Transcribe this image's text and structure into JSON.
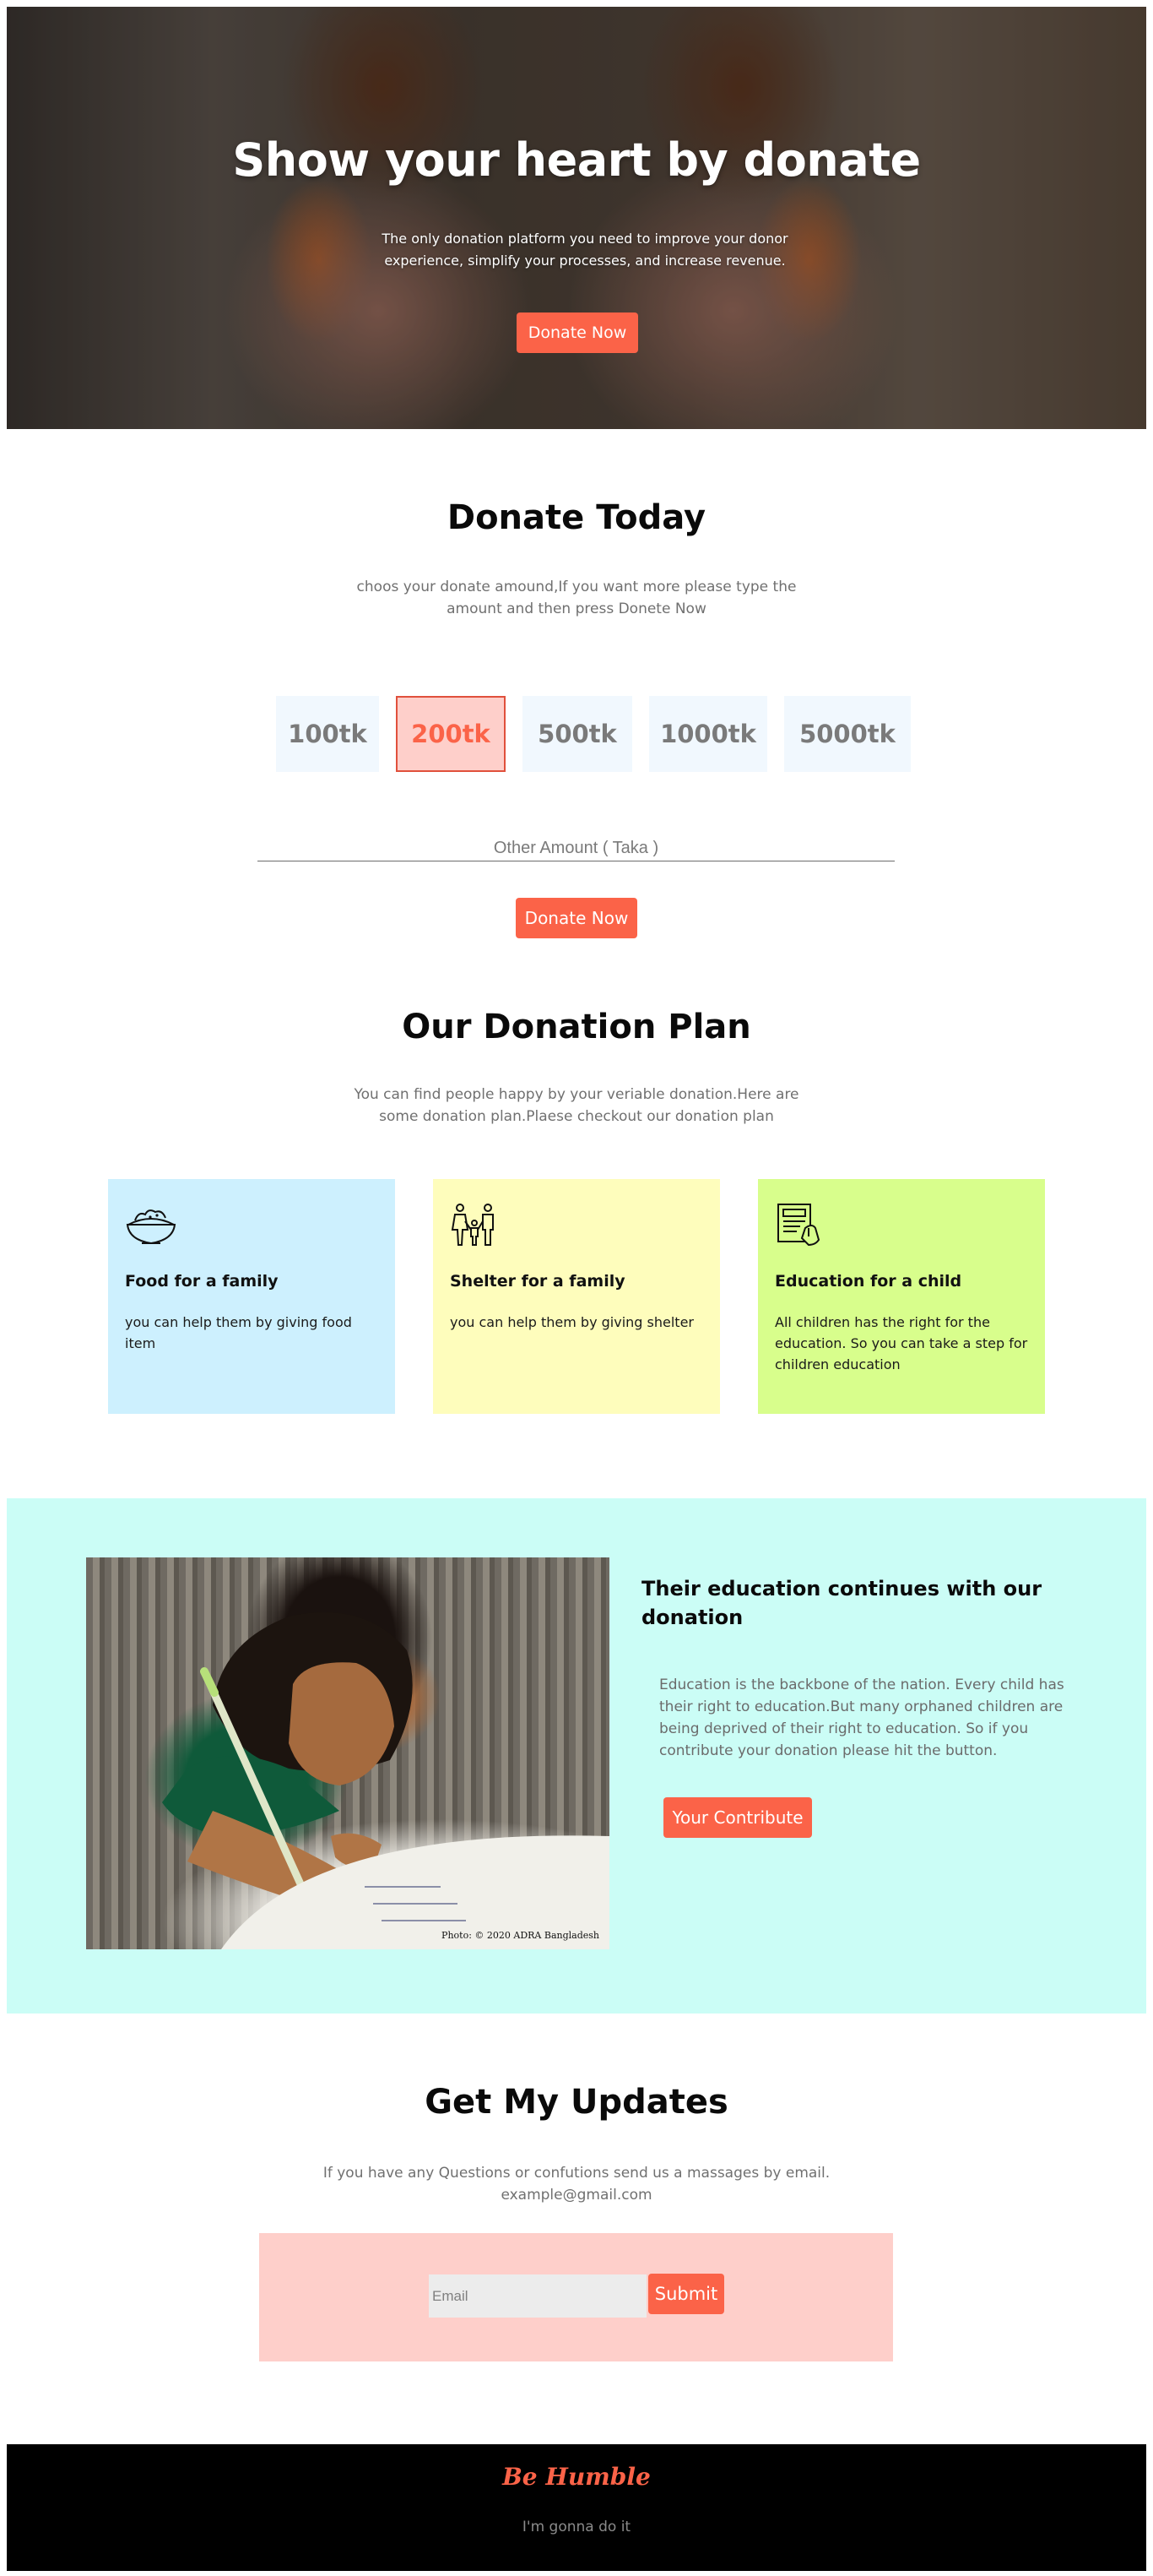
{
  "hero": {
    "title": "Show your heart by donate",
    "subtitle": "The only donation platform you need to improve your donor experience, simplify your processes, and increase revenue.",
    "button_label": "Donate Now"
  },
  "donate_today": {
    "title": "Donate Today",
    "subtitle": "choos your donate amound,If you want more please type the amount and then press Donete Now",
    "amounts": [
      "100tk",
      "200tk",
      "500tk",
      "1000tk",
      "5000tk"
    ],
    "selected_amount": "200tk",
    "other_placeholder": "Other Amount ( Taka )",
    "button_label": "Donate Now"
  },
  "plan": {
    "title": "Our Donation Plan",
    "subtitle": "You can find people happy by your veriable donation.Here are some donation plan.Plaese checkout our donation plan",
    "cards": [
      {
        "icon": "food-bowl-icon",
        "title": "Food for a family",
        "text": "you can help them by giving food item",
        "color": "#cdf0fe"
      },
      {
        "icon": "family-icon",
        "title": "Shelter for a family",
        "text": "you can help them by giving shelter",
        "color": "#fefdbc"
      },
      {
        "icon": "education-icon",
        "title": "Education for a child",
        "text": "All children has the right for the education. So you can take a step for children education",
        "color": "#d8fe8c"
      }
    ]
  },
  "education": {
    "title": "Their education continues with our donation",
    "text": "Education is the backbone of the nation. Every child has their right to education.But many orphaned children are being deprived of their right to education. So if you contribute your donation please hit the button.",
    "button_label": "Your Contribute",
    "photo_credit": "Photo: © 2020 ADRA Bangladesh"
  },
  "updates": {
    "title": "Get My Updates",
    "subtitle_line1": "If you have any Questions or confutions send us a massages by email.",
    "subtitle_line2": "example@gmail.com",
    "email_placeholder": "Email",
    "submit_label": "Submit"
  },
  "footer": {
    "brand": "Be Humble",
    "tagline": "I'm gonna do it"
  },
  "colors": {
    "accent": "#fb6348",
    "edu_bg": "#cbfdf6",
    "email_box_bg": "#fecfca",
    "amount_bg": "#f1f8fe"
  }
}
